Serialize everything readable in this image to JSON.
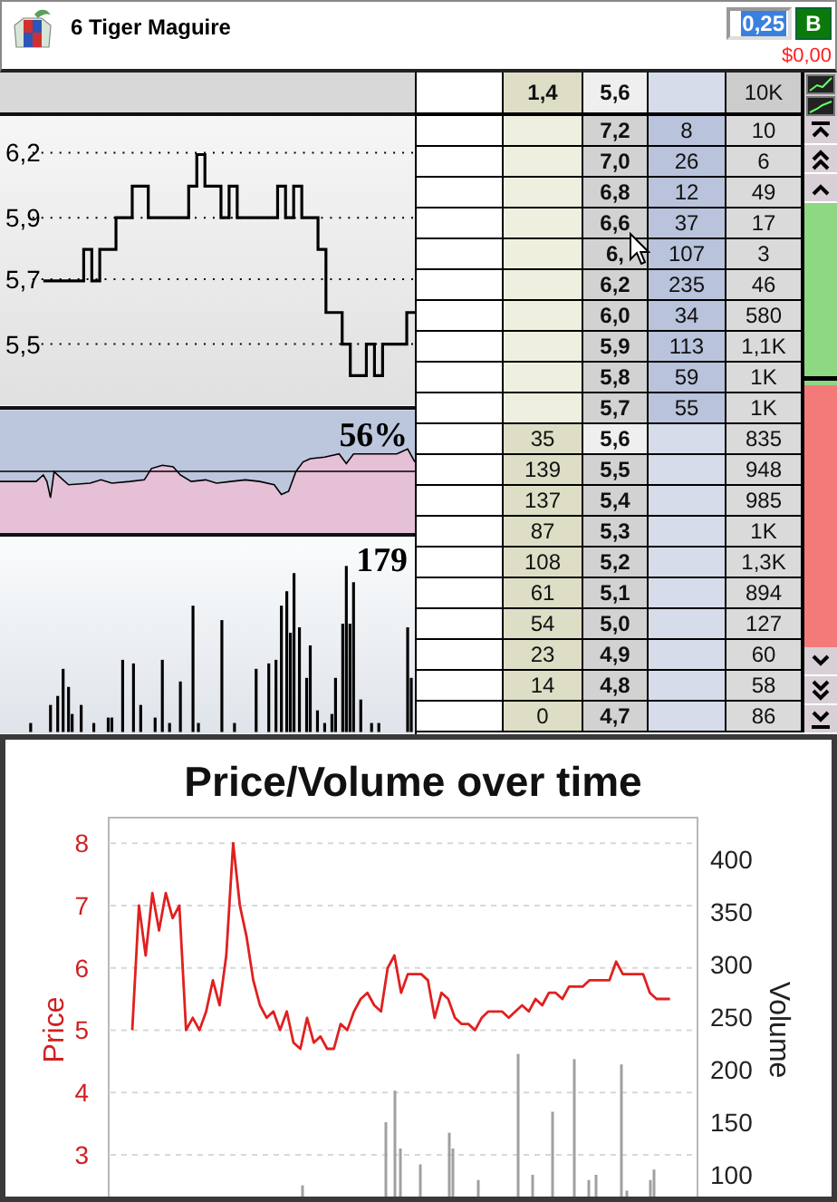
{
  "runner": {
    "name": "6 Tiger Maguire",
    "stake": "0,25",
    "side_button": "B",
    "profit": "$0,00"
  },
  "price_chart": {
    "axis_labels": [
      "6,2",
      "5,9",
      "5,7",
      "5,5"
    ]
  },
  "weight_of_money": {
    "percent": "56%"
  },
  "volume_histogram": {
    "max": "179"
  },
  "ladder": {
    "header": {
      "back_total": "1,4",
      "last_price": "5,6",
      "traded_total": "10K"
    },
    "rows": [
      {
        "price": "7,2",
        "lay": "8",
        "traded": "10",
        "last_traded": false
      },
      {
        "price": "7,0",
        "lay": "26",
        "traded": "6",
        "last_traded": false
      },
      {
        "price": "6,8",
        "lay": "12",
        "traded": "49",
        "last_traded": false
      },
      {
        "price": "6,6",
        "lay": "37",
        "traded": "17",
        "last_traded": false
      },
      {
        "price": "6,",
        "lay": "107",
        "traded": "3",
        "last_traded": false
      },
      {
        "price": "6,2",
        "lay": "235",
        "traded": "46",
        "last_traded": false
      },
      {
        "price": "6,0",
        "lay": "34",
        "traded": "580",
        "last_traded": false
      },
      {
        "price": "5,9",
        "lay": "113",
        "traded": "1,1K",
        "last_traded": false
      },
      {
        "price": "5,8",
        "lay": "59",
        "traded": "1K",
        "last_traded": false
      },
      {
        "price": "5,7",
        "lay": "55",
        "traded": "1K",
        "last_traded": false
      },
      {
        "back": "35",
        "price": "5,6",
        "traded": "835",
        "last_traded": true
      },
      {
        "back": "139",
        "price": "5,5",
        "traded": "948",
        "last_traded": false
      },
      {
        "back": "137",
        "price": "5,4",
        "traded": "985",
        "last_traded": false
      },
      {
        "back": "87",
        "price": "5,3",
        "traded": "1K",
        "last_traded": false
      },
      {
        "back": "108",
        "price": "5,2",
        "traded": "1,3K",
        "last_traded": false
      },
      {
        "back": "61",
        "price": "5,1",
        "traded": "894",
        "last_traded": false
      },
      {
        "back": "54",
        "price": "5,0",
        "traded": "127",
        "last_traded": false
      },
      {
        "back": "23",
        "price": "4,9",
        "traded": "60",
        "last_traded": false
      },
      {
        "back": "14",
        "price": "4,8",
        "traded": "58",
        "last_traded": false
      },
      {
        "back": "0",
        "price": "4,7",
        "traded": "86",
        "last_traded": false
      }
    ]
  },
  "history_chart": {
    "volume_axis": {
      "title": "Volume",
      "ticks": [
        "400",
        "350",
        "300",
        "250",
        "200",
        "150",
        "100"
      ]
    },
    "chart_data": {
      "type": "line",
      "title": "Price/Volume over time",
      "ylabel": "Price",
      "ylim": [
        1.72,
        8.41
      ],
      "grid": true,
      "yticks": [
        3,
        4,
        5,
        6,
        7,
        8
      ],
      "series": [
        {
          "color": "#e02020",
          "values": [
            5,
            7,
            6.2,
            7.2,
            6.6,
            7.2,
            6.8,
            7,
            5,
            5.2,
            5,
            5.3,
            5.8,
            5.4,
            6.2,
            8,
            7,
            6.5,
            5.8,
            5.4,
            5.2,
            5.3,
            5,
            5.3,
            4.8,
            4.7,
            5.2,
            4.8,
            4.9,
            4.7,
            4.7,
            5.1,
            5,
            5.3,
            5.5,
            5.6,
            5.4,
            5.3,
            6,
            6.2,
            5.6,
            5.9,
            5.9,
            5.9,
            5.8,
            5.2,
            5.6,
            5.5,
            5.2,
            5.1,
            5.1,
            5,
            5.2,
            5.3,
            5.3,
            5.3,
            5.2,
            5.3,
            5.4,
            5.3,
            5.5,
            5.4,
            5.6,
            5.6,
            5.5,
            5.7,
            5.7,
            5.7,
            5.8,
            5.8,
            5.8,
            5.8,
            6.1,
            5.9,
            5.9,
            5.9,
            5.9,
            5.6,
            5.5,
            5.5,
            5.5
          ]
        }
      ]
    }
  }
}
